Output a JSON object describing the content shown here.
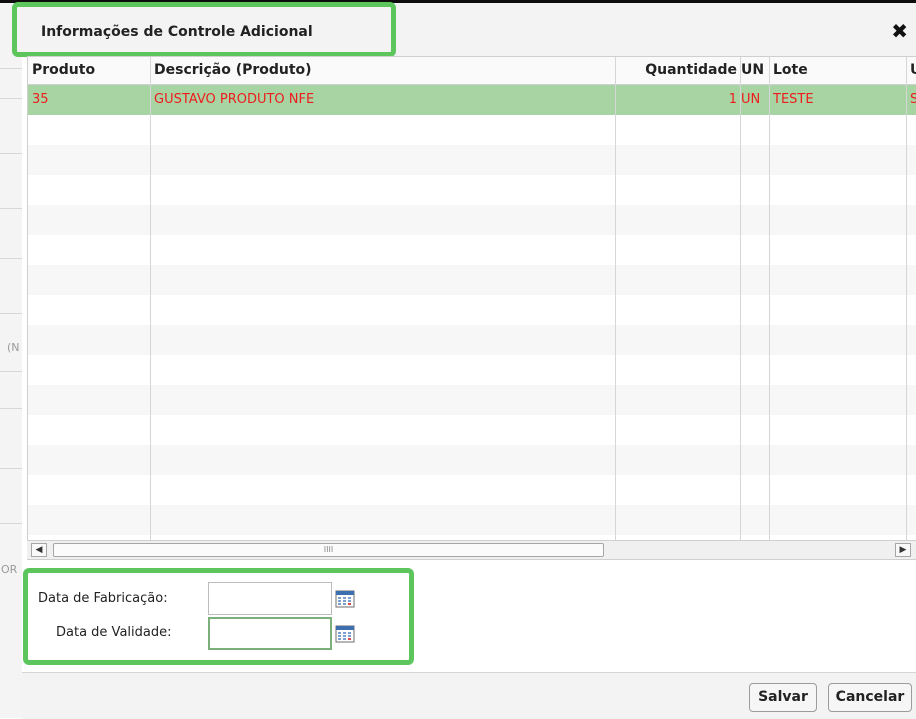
{
  "dialog": {
    "title": "Informações de Controle Adicional",
    "close_symbol": "✖"
  },
  "grid": {
    "columns": [
      "Produto",
      "Descrição (Produto)",
      "Quantidade",
      "UN",
      "Lote",
      "U"
    ],
    "rows": [
      {
        "produto": "35",
        "descricao": "GUSTAVO PRODUTO NFE",
        "quantidade": "1",
        "un": "UN",
        "lote": "TESTE",
        "extra": "S"
      }
    ],
    "scroll": {
      "left_arrow": "◀",
      "right_arrow": "▶",
      "thumb_grip": "IIII"
    }
  },
  "form": {
    "fabricacao_label": "Data de Fabricação:",
    "fabricacao_value": "",
    "validade_label": "Data de Validade:",
    "validade_value": ""
  },
  "footer": {
    "save_label": "Salvar",
    "cancel_label": "Cancelar"
  },
  "background": {
    "fragment_1": "(N",
    "fragment_2": "OR"
  },
  "colors": {
    "highlight_border": "#5cc65c",
    "selected_row": "#a8d4a4",
    "row_text": "#ee1c1c"
  },
  "icons": [
    "close-icon",
    "calendar-icon",
    "scroll-left-icon",
    "scroll-right-icon"
  ]
}
